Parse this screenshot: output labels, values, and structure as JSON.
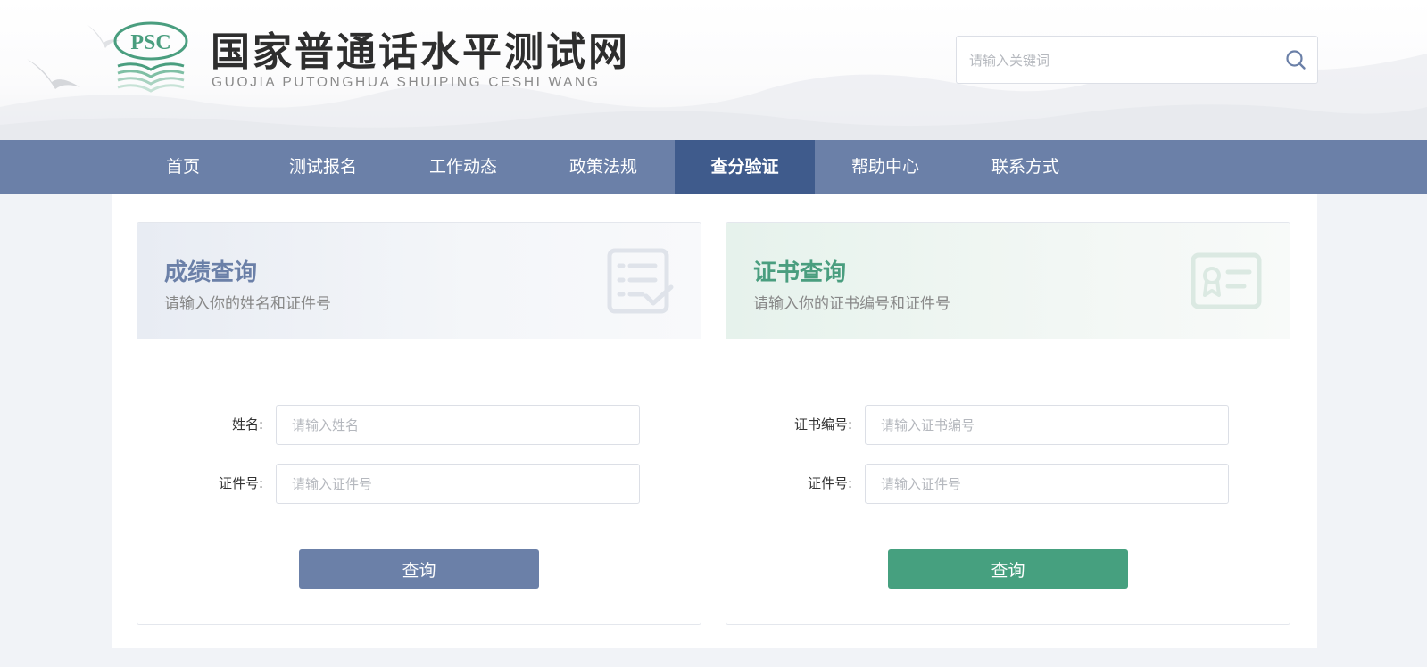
{
  "header": {
    "site_title": "国家普通话水平测试网",
    "site_subtitle": "GUOJIA PUTONGHUA SHUIPING CESHI WANG",
    "logo_text": "PSC",
    "search_placeholder": "请输入关键词"
  },
  "nav": {
    "items": [
      {
        "label": "首页"
      },
      {
        "label": "测试报名"
      },
      {
        "label": "工作动态"
      },
      {
        "label": "政策法规"
      },
      {
        "label": "查分验证"
      },
      {
        "label": "帮助中心"
      },
      {
        "label": "联系方式"
      }
    ],
    "active_index": 4
  },
  "score_query": {
    "title": "成绩查询",
    "subtitle": "请输入你的姓名和证件号",
    "name_label": "姓名:",
    "name_placeholder": "请输入姓名",
    "id_label": "证件号:",
    "id_placeholder": "请输入证件号",
    "button_label": "查询"
  },
  "cert_query": {
    "title": "证书查询",
    "subtitle": "请输入你的证书编号和证件号",
    "cert_label": "证书编号:",
    "cert_placeholder": "请输入证书编号",
    "id_label": "证件号:",
    "id_placeholder": "请输入证件号",
    "button_label": "查询"
  },
  "colors": {
    "nav_bg": "#6b80a8",
    "nav_active": "#3f5b8c",
    "score_accent": "#6b80a8",
    "cert_accent": "#46a07f",
    "logo_green": "#4a9e7f"
  }
}
